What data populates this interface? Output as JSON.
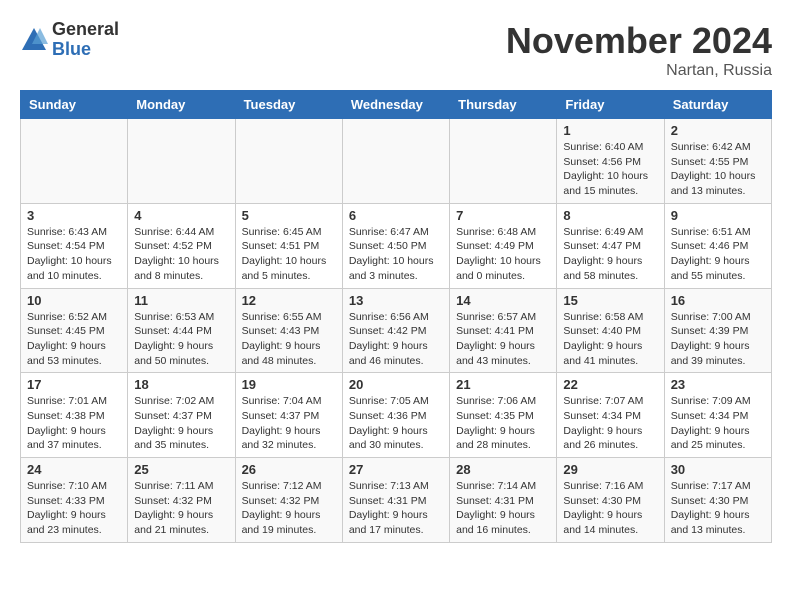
{
  "header": {
    "logo_general": "General",
    "logo_blue": "Blue",
    "month": "November 2024",
    "location": "Nartan, Russia"
  },
  "days_of_week": [
    "Sunday",
    "Monday",
    "Tuesday",
    "Wednesday",
    "Thursday",
    "Friday",
    "Saturday"
  ],
  "weeks": [
    [
      {
        "day": "",
        "info": ""
      },
      {
        "day": "",
        "info": ""
      },
      {
        "day": "",
        "info": ""
      },
      {
        "day": "",
        "info": ""
      },
      {
        "day": "",
        "info": ""
      },
      {
        "day": "1",
        "info": "Sunrise: 6:40 AM\nSunset: 4:56 PM\nDaylight: 10 hours\nand 15 minutes."
      },
      {
        "day": "2",
        "info": "Sunrise: 6:42 AM\nSunset: 4:55 PM\nDaylight: 10 hours\nand 13 minutes."
      }
    ],
    [
      {
        "day": "3",
        "info": "Sunrise: 6:43 AM\nSunset: 4:54 PM\nDaylight: 10 hours\nand 10 minutes."
      },
      {
        "day": "4",
        "info": "Sunrise: 6:44 AM\nSunset: 4:52 PM\nDaylight: 10 hours\nand 8 minutes."
      },
      {
        "day": "5",
        "info": "Sunrise: 6:45 AM\nSunset: 4:51 PM\nDaylight: 10 hours\nand 5 minutes."
      },
      {
        "day": "6",
        "info": "Sunrise: 6:47 AM\nSunset: 4:50 PM\nDaylight: 10 hours\nand 3 minutes."
      },
      {
        "day": "7",
        "info": "Sunrise: 6:48 AM\nSunset: 4:49 PM\nDaylight: 10 hours\nand 0 minutes."
      },
      {
        "day": "8",
        "info": "Sunrise: 6:49 AM\nSunset: 4:47 PM\nDaylight: 9 hours\nand 58 minutes."
      },
      {
        "day": "9",
        "info": "Sunrise: 6:51 AM\nSunset: 4:46 PM\nDaylight: 9 hours\nand 55 minutes."
      }
    ],
    [
      {
        "day": "10",
        "info": "Sunrise: 6:52 AM\nSunset: 4:45 PM\nDaylight: 9 hours\nand 53 minutes."
      },
      {
        "day": "11",
        "info": "Sunrise: 6:53 AM\nSunset: 4:44 PM\nDaylight: 9 hours\nand 50 minutes."
      },
      {
        "day": "12",
        "info": "Sunrise: 6:55 AM\nSunset: 4:43 PM\nDaylight: 9 hours\nand 48 minutes."
      },
      {
        "day": "13",
        "info": "Sunrise: 6:56 AM\nSunset: 4:42 PM\nDaylight: 9 hours\nand 46 minutes."
      },
      {
        "day": "14",
        "info": "Sunrise: 6:57 AM\nSunset: 4:41 PM\nDaylight: 9 hours\nand 43 minutes."
      },
      {
        "day": "15",
        "info": "Sunrise: 6:58 AM\nSunset: 4:40 PM\nDaylight: 9 hours\nand 41 minutes."
      },
      {
        "day": "16",
        "info": "Sunrise: 7:00 AM\nSunset: 4:39 PM\nDaylight: 9 hours\nand 39 minutes."
      }
    ],
    [
      {
        "day": "17",
        "info": "Sunrise: 7:01 AM\nSunset: 4:38 PM\nDaylight: 9 hours\nand 37 minutes."
      },
      {
        "day": "18",
        "info": "Sunrise: 7:02 AM\nSunset: 4:37 PM\nDaylight: 9 hours\nand 35 minutes."
      },
      {
        "day": "19",
        "info": "Sunrise: 7:04 AM\nSunset: 4:37 PM\nDaylight: 9 hours\nand 32 minutes."
      },
      {
        "day": "20",
        "info": "Sunrise: 7:05 AM\nSunset: 4:36 PM\nDaylight: 9 hours\nand 30 minutes."
      },
      {
        "day": "21",
        "info": "Sunrise: 7:06 AM\nSunset: 4:35 PM\nDaylight: 9 hours\nand 28 minutes."
      },
      {
        "day": "22",
        "info": "Sunrise: 7:07 AM\nSunset: 4:34 PM\nDaylight: 9 hours\nand 26 minutes."
      },
      {
        "day": "23",
        "info": "Sunrise: 7:09 AM\nSunset: 4:34 PM\nDaylight: 9 hours\nand 25 minutes."
      }
    ],
    [
      {
        "day": "24",
        "info": "Sunrise: 7:10 AM\nSunset: 4:33 PM\nDaylight: 9 hours\nand 23 minutes."
      },
      {
        "day": "25",
        "info": "Sunrise: 7:11 AM\nSunset: 4:32 PM\nDaylight: 9 hours\nand 21 minutes."
      },
      {
        "day": "26",
        "info": "Sunrise: 7:12 AM\nSunset: 4:32 PM\nDaylight: 9 hours\nand 19 minutes."
      },
      {
        "day": "27",
        "info": "Sunrise: 7:13 AM\nSunset: 4:31 PM\nDaylight: 9 hours\nand 17 minutes."
      },
      {
        "day": "28",
        "info": "Sunrise: 7:14 AM\nSunset: 4:31 PM\nDaylight: 9 hours\nand 16 minutes."
      },
      {
        "day": "29",
        "info": "Sunrise: 7:16 AM\nSunset: 4:30 PM\nDaylight: 9 hours\nand 14 minutes."
      },
      {
        "day": "30",
        "info": "Sunrise: 7:17 AM\nSunset: 4:30 PM\nDaylight: 9 hours\nand 13 minutes."
      }
    ]
  ]
}
